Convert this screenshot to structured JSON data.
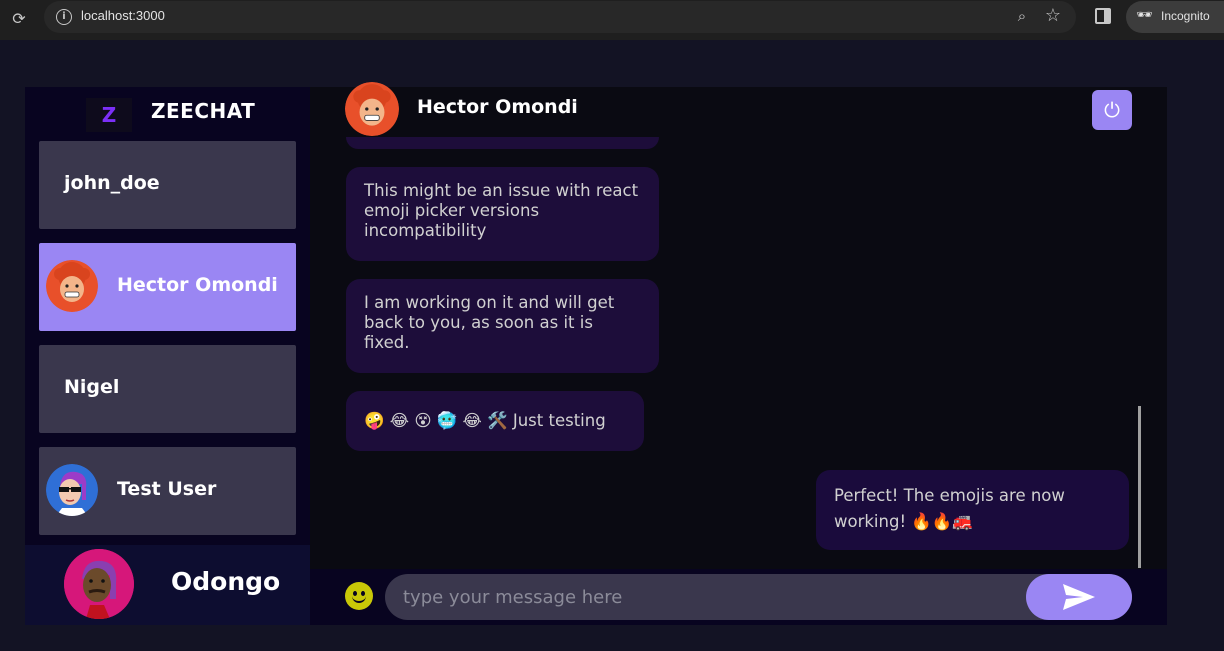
{
  "browser": {
    "url": "localhost:3000",
    "incognito_label": "Incognito"
  },
  "sidebar": {
    "brand_logo": "Z",
    "brand_name": "ZEECHAT",
    "contacts": [
      {
        "name": "john_doe"
      },
      {
        "name": "Hector Omondi"
      },
      {
        "name": "Nigel"
      },
      {
        "name": "Test User"
      }
    ],
    "current_user": {
      "name": "Odongo"
    }
  },
  "chat": {
    "header": {
      "name": "Hector Omondi"
    },
    "messages": [
      {
        "text": "This might be an issue with react emoji picker versions incompatibility",
        "direction": "received"
      },
      {
        "text": "I am working on it and will get back to you, as soon as it is fixed.",
        "direction": "received"
      },
      {
        "text": "🤪 😂 😵 🥶 😂 🛠️  Just testing",
        "direction": "received"
      },
      {
        "text": "Perfect! The emojis are now working! 🔥🔥🚒",
        "direction": "sent"
      }
    ],
    "input": {
      "placeholder": "type your message here"
    }
  },
  "colors": {
    "accent": "#9a86f3",
    "bubble": "#1d0d3a",
    "sidebar": "#080420",
    "background": "#131324"
  }
}
